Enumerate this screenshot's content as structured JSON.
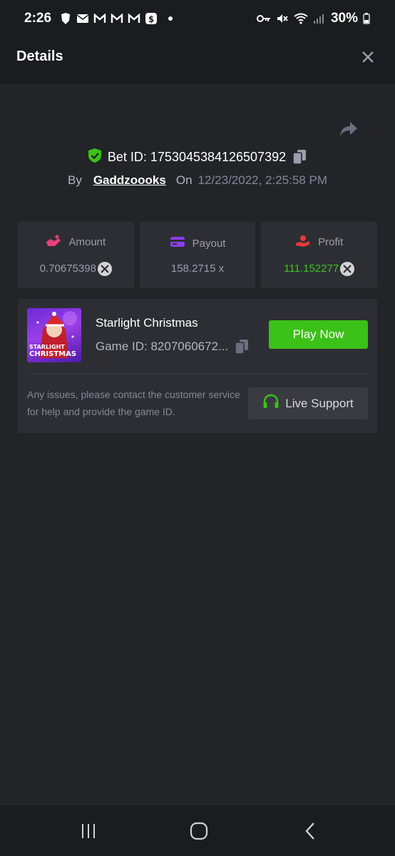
{
  "status_bar": {
    "time": "2:26",
    "battery": "30%",
    "icons_left": [
      "brave-icon",
      "email-icon",
      "gmail-icon",
      "gmail-icon",
      "gmail-icon",
      "cash-app-icon",
      "dot"
    ],
    "icons_right": [
      "key-icon",
      "mute-icon",
      "wifi-icon",
      "signal-icon",
      "battery-icon"
    ]
  },
  "header": {
    "title": "Details"
  },
  "bet": {
    "id_label": "Bet ID: 1753045384126507392",
    "by_label": "By",
    "user": "Gaddzoooks",
    "on_label": "On",
    "date": "12/23/2022, 2:25:58 PM"
  },
  "stats": {
    "amount": {
      "label": "Amount",
      "value": "0.70675398",
      "color": "#e8417a"
    },
    "payout": {
      "label": "Payout",
      "value": "158.2715 x",
      "color": "#8b3cf0"
    },
    "profit": {
      "label": "Profit",
      "value": "111.152277",
      "color": "#e53b3b",
      "value_color": "#3dc428"
    }
  },
  "game": {
    "name": "Starlight Christmas",
    "id_label": "Game ID: 8207060672...",
    "thumb_line1": "STARLIGHT",
    "thumb_line2": "CHRISTMAS",
    "play_label": "Play Now",
    "support_text": "Any issues, please contact the customer service for help and provide the game ID.",
    "support_label": "Live Support"
  },
  "colors": {
    "accent_green": "#3bc117",
    "shield_green": "#3bc117"
  }
}
